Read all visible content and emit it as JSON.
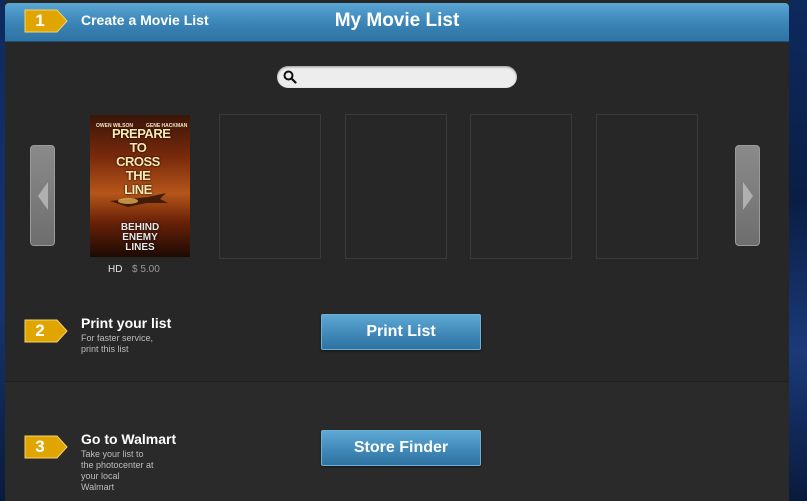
{
  "header": {
    "title": "My Movie List",
    "step1": {
      "number": "1",
      "label": "Create a Movie List"
    }
  },
  "search": {
    "placeholder": "",
    "value": "",
    "icon": "search-icon"
  },
  "carousel": {
    "prev_icon": "chevron-left-icon",
    "next_icon": "chevron-right-icon",
    "movies": [
      {
        "poster": {
          "actor_left": "OWEN WILSON",
          "actor_right": "GENE HACKMAN",
          "tagline": "PREPARE TO CROSS THE LINE",
          "title": "BEHIND ENEMY LINES"
        },
        "format": "HD",
        "price": "$ 5.00"
      }
    ],
    "empty_slots": 4
  },
  "step2": {
    "number": "2",
    "title": "Print your list",
    "desc_line1": "For faster service,",
    "desc_line2": "print this list",
    "button_label": "Print List"
  },
  "step3": {
    "number": "3",
    "title": "Go to Walmart",
    "desc_line1": "Take your list to",
    "desc_line2": "the photocenter at",
    "desc_line3": "your local",
    "desc_line4": "Walmart",
    "button_label": "Store Finder"
  },
  "colors": {
    "badge": "#e0a500",
    "header_blue": "#3c86b8",
    "panel": "#272727",
    "button_blue": "#4089b9"
  }
}
